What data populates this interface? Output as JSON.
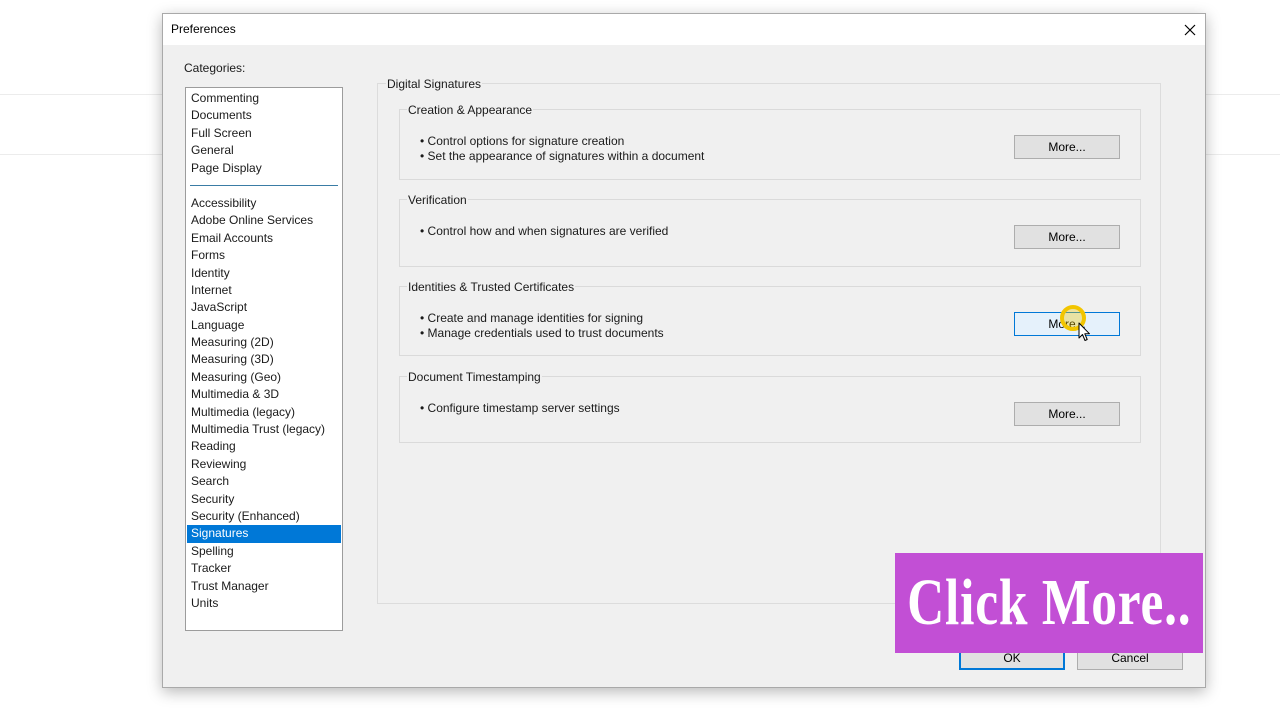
{
  "dialog": {
    "title": "Preferences",
    "categories_label": "Categories:",
    "top_categories": [
      "Commenting",
      "Documents",
      "Full Screen",
      "General",
      "Page Display"
    ],
    "categories": [
      "Accessibility",
      "Adobe Online Services",
      "Email Accounts",
      "Forms",
      "Identity",
      "Internet",
      "JavaScript",
      "Language",
      "Measuring (2D)",
      "Measuring (3D)",
      "Measuring (Geo)",
      "Multimedia & 3D",
      "Multimedia (legacy)",
      "Multimedia Trust (legacy)",
      "Reading",
      "Reviewing",
      "Search",
      "Security",
      "Security (Enhanced)",
      "Signatures",
      "Spelling",
      "Tracker",
      "Trust Manager",
      "Units"
    ],
    "selected_category": "Signatures",
    "ok_label": "OK",
    "cancel_label": "Cancel"
  },
  "panel": {
    "title": "Digital Signatures",
    "groups": [
      {
        "title": "Creation & Appearance",
        "lines": [
          "Control options for signature creation",
          "Set the appearance of signatures within a document"
        ],
        "button": "More..."
      },
      {
        "title": "Verification",
        "lines": [
          "Control how and when signatures are verified"
        ],
        "button": "More..."
      },
      {
        "title": "Identities & Trusted Certificates",
        "lines": [
          "Create and manage identities for signing",
          "Manage credentials used to trust documents"
        ],
        "button": "More..."
      },
      {
        "title": "Document Timestamping",
        "lines": [
          "Configure timestamp server settings"
        ],
        "button": "More..."
      }
    ]
  },
  "overlay": {
    "text": "Click More.."
  },
  "icons": {
    "close": "close-icon",
    "cursor": "mouse-pointer-icon",
    "click_highlight": "click-highlight-icon"
  },
  "colors": {
    "selection": "#0078d7",
    "overlay_bg": "#c24fd5",
    "highlight": "#f2c500"
  }
}
